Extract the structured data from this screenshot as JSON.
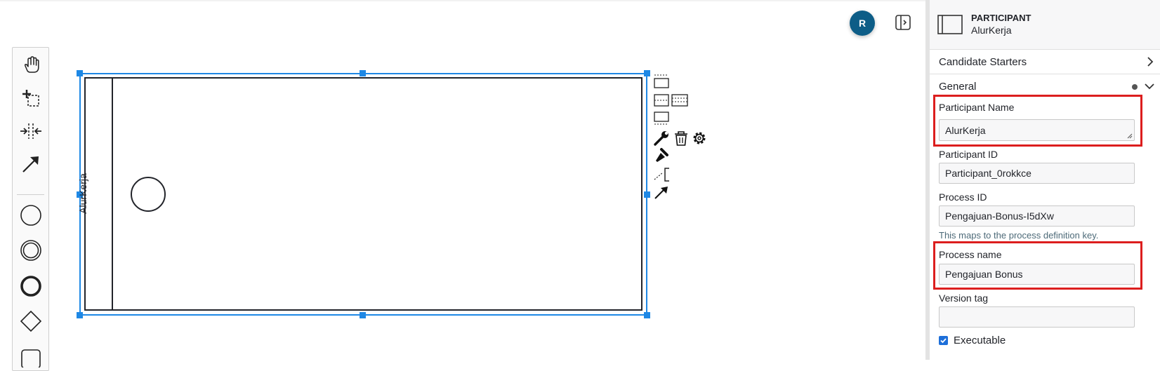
{
  "canvas": {
    "pool_name": "AlurKerja",
    "avatar_initial": "R"
  },
  "palette": {
    "tools": [
      "hand-tool-icon",
      "lasso-tool-icon",
      "space-tool-icon",
      "global-connect-icon",
      "start-event-icon",
      "intermediate-event-icon",
      "end-event-icon",
      "gateway-icon",
      "task-icon"
    ]
  },
  "context_pad": {
    "entries": [
      "lane-insert-above-icon",
      "lane-divide-two-icon",
      "lane-divide-three-icon",
      "lane-insert-below-icon",
      "change-type-wrench-icon",
      "delete-trash-icon",
      "settings-gear-icon",
      "color-brush-icon",
      "text-annotation-icon",
      "connect-arrow-icon"
    ]
  },
  "properties": {
    "element_type": "PARTICIPANT",
    "element_name": "AlurKerja",
    "groups": {
      "candidate_starters": "Candidate Starters",
      "general": "General"
    },
    "fields": {
      "participant_name_label": "Participant Name",
      "participant_name_value": "AlurKerja",
      "participant_id_label": "Participant ID",
      "participant_id_value": "Participant_0rokkce",
      "process_id_label": "Process ID",
      "process_id_value": "Pengajuan-Bonus-I5dXw",
      "process_id_hint": "This maps to the process definition key.",
      "process_name_label": "Process name",
      "process_name_value": "Pengajuan Bonus",
      "version_tag_label": "Version tag",
      "version_tag_value": "",
      "executable_label": "Executable",
      "executable_checked": true
    },
    "highlight_color": "#dc1e1e",
    "accent_color": "#1e6fd9"
  }
}
